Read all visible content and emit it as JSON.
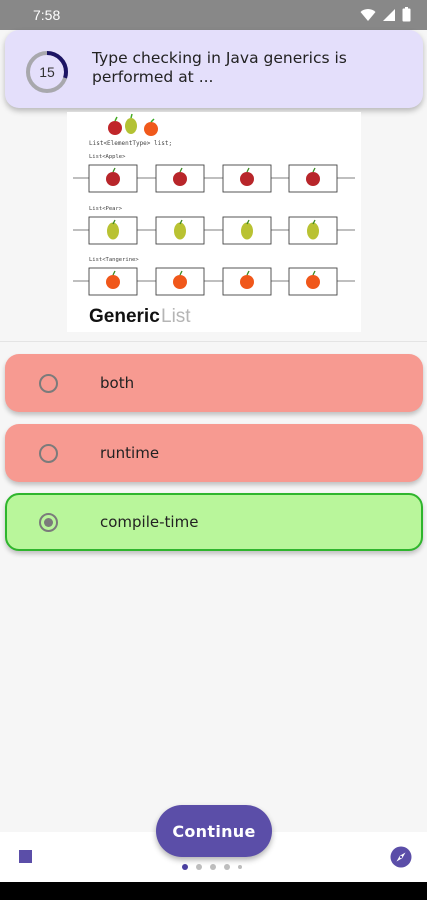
{
  "status_bar": {
    "time": "7:58"
  },
  "question": {
    "timer_value": "15",
    "timer_progress": 0.3,
    "text": "Type checking in Java generics is performed at ..."
  },
  "illustration": {
    "declaration": "List<ElementType> list;",
    "rows": [
      {
        "label": "List<Apple>",
        "fruit": "apple",
        "count": 4
      },
      {
        "label": "List<Pear>",
        "fruit": "pear",
        "count": 4
      },
      {
        "label": "List<Tangerine>",
        "fruit": "tangerine",
        "count": 4
      }
    ],
    "caption_bold": "Generic",
    "caption_light": "List"
  },
  "options": [
    {
      "label": "both",
      "state": "wrong",
      "selected": false
    },
    {
      "label": "runtime",
      "state": "wrong",
      "selected": false
    },
    {
      "label": "compile-time",
      "state": "correct",
      "selected": true
    }
  ],
  "footer": {
    "continue_label": "Continue",
    "page_dots": 5,
    "active_dot": 0
  },
  "colors": {
    "accent": "#5b4ea8",
    "question_bg": "#e4dffb",
    "wrong_bg": "#f79a91",
    "correct_bg": "#b9f69b",
    "correct_border": "#2fb52d"
  },
  "icons": [
    "wifi-icon",
    "signal-icon",
    "battery-icon",
    "stop-icon",
    "compass-icon"
  ]
}
